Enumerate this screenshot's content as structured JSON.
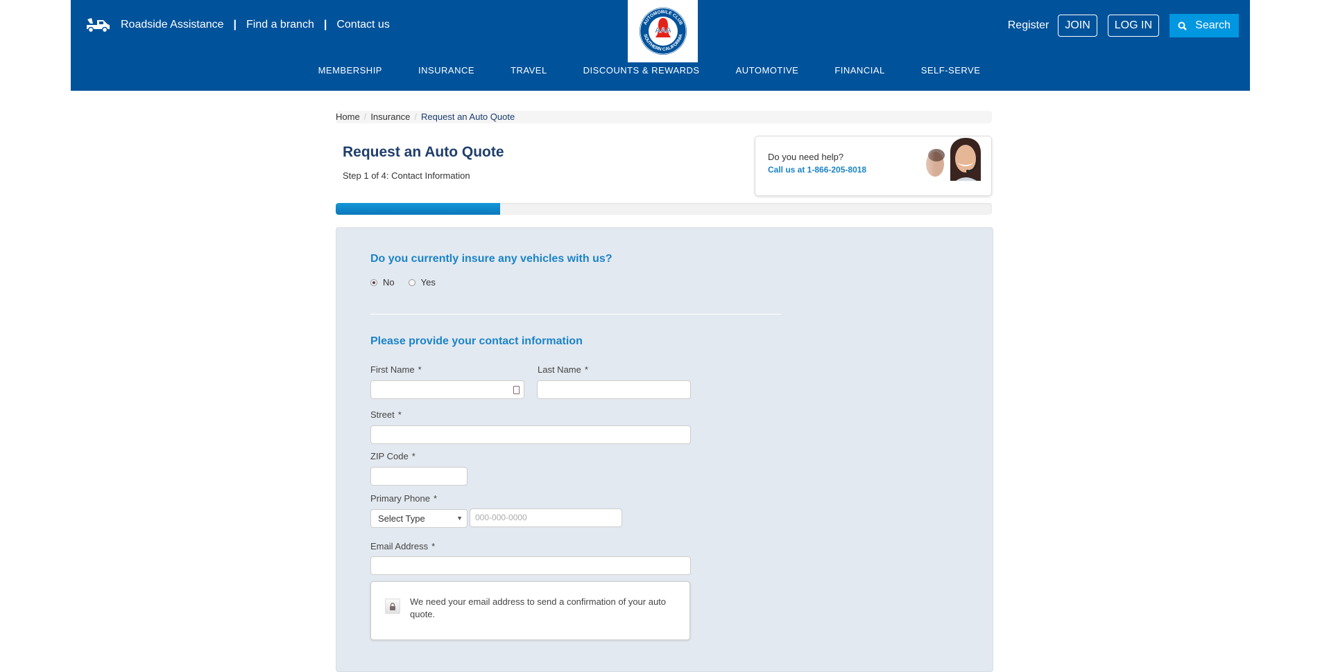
{
  "header": {
    "utility_links": [
      {
        "label": "Roadside Assistance",
        "icon": "tow-truck-icon"
      },
      {
        "label": "Find a branch"
      },
      {
        "label": "Contact us"
      }
    ],
    "separator": "|",
    "logo": {
      "alt": "Automobile Club of Southern California AAA"
    },
    "register_label": "Register",
    "join_label": "JOIN",
    "login_label": "LOG IN",
    "search_label": "Search",
    "main_nav": [
      "MEMBERSHIP",
      "INSURANCE",
      "TRAVEL",
      "DISCOUNTS & REWARDS",
      "AUTOMOTIVE",
      "FINANCIAL",
      "SELF-SERVE"
    ],
    "colors": {
      "header_bg": "#00529b",
      "search_bg": "#0096e0"
    }
  },
  "breadcrumb": {
    "items": [
      "Home",
      "Insurance",
      "Request an Auto Quote"
    ],
    "separator": "/"
  },
  "page": {
    "title": "Request an Auto Quote",
    "step": "Step 1 of 4: Contact Information",
    "progress_percent": 25
  },
  "help": {
    "question": "Do you need help?",
    "call": "Call us at 1-866-205-8018"
  },
  "form": {
    "insure_question": "Do you currently insure any vehicles with us?",
    "insure_options": [
      {
        "label": "No",
        "checked": true
      },
      {
        "label": "Yes",
        "checked": false
      }
    ],
    "contact_heading": "Please provide your contact information",
    "required_marker": "*",
    "first_name": {
      "label": "First Name",
      "value": ""
    },
    "last_name": {
      "label": "Last Name",
      "value": ""
    },
    "street": {
      "label": "Street",
      "value": ""
    },
    "zip": {
      "label": "ZIP Code",
      "value": ""
    },
    "phone": {
      "label": "Primary Phone",
      "type_selected": "Select Type",
      "placeholder": "000-000-0000",
      "value": ""
    },
    "email": {
      "label": "Email Address",
      "value": ""
    },
    "email_note": "We need your email address to send a confirmation of your auto quote."
  }
}
